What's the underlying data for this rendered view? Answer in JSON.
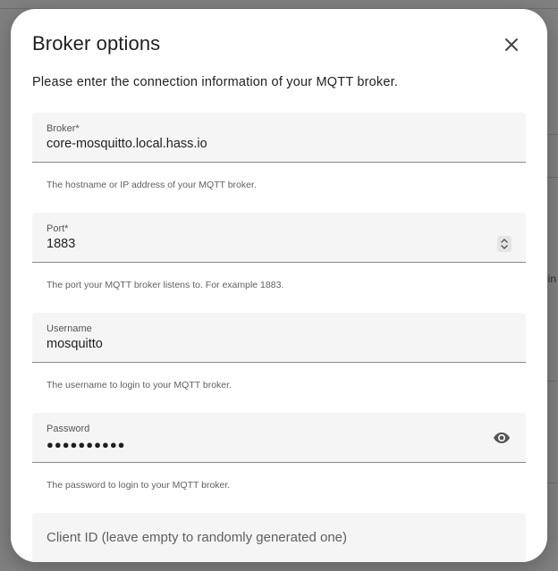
{
  "dialog": {
    "title": "Broker options",
    "description": "Please enter the connection information of your MQTT broker.",
    "close_icon": "close-icon"
  },
  "fields": {
    "broker": {
      "label": "Broker*",
      "value": "core-mosquitto.local.hass.io",
      "helper": "The hostname or IP address of your MQTT broker."
    },
    "port": {
      "label": "Port*",
      "value": "1883",
      "helper": "The port your MQTT broker listens to. For example 1883.",
      "spinner_icon": "spinner-arrows-icon"
    },
    "username": {
      "label": "Username",
      "value": "mosquitto",
      "helper": "The username to login to your MQTT broker."
    },
    "password": {
      "label": "Password",
      "value": "●●●●●●●●●●",
      "helper": "The password to login to your MQTT broker.",
      "toggle_icon": "eye-icon"
    },
    "client_id": {
      "placeholder": "Client ID (leave empty to randomly generated one)"
    }
  },
  "background": {
    "fragment": "in"
  }
}
